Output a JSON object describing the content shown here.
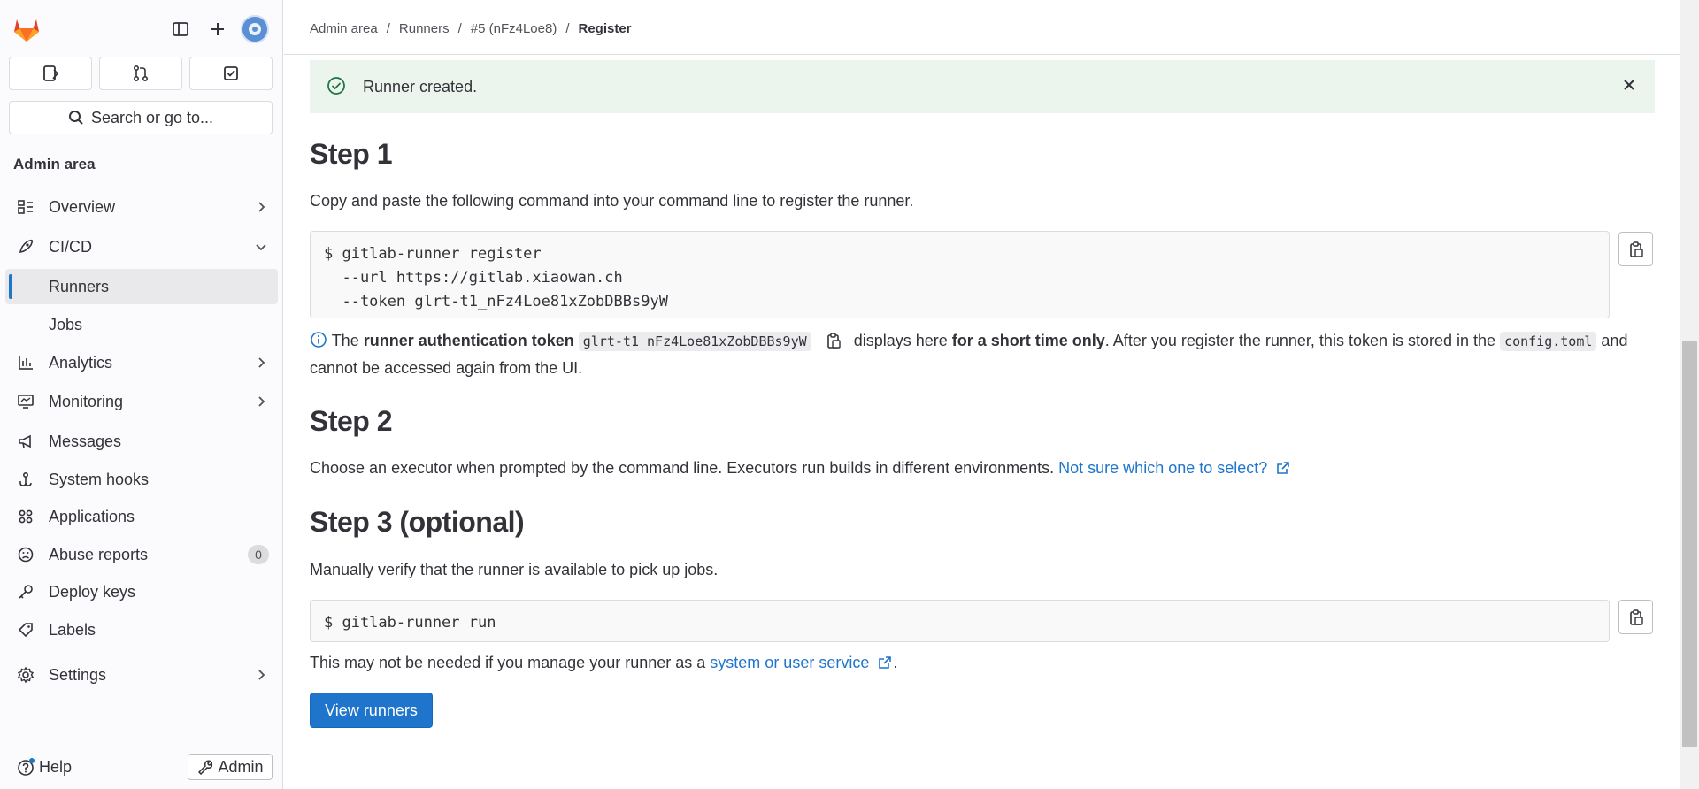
{
  "sidebar": {
    "search_label": "Search or go to...",
    "section_title": "Admin area",
    "items": [
      {
        "label": "Overview"
      },
      {
        "label": "CI/CD"
      },
      {
        "label": "Runners"
      },
      {
        "label": "Jobs"
      },
      {
        "label": "Analytics"
      },
      {
        "label": "Monitoring"
      },
      {
        "label": "Messages"
      },
      {
        "label": "System hooks"
      },
      {
        "label": "Applications"
      },
      {
        "label": "Abuse reports",
        "badge": "0"
      },
      {
        "label": "Deploy keys"
      },
      {
        "label": "Labels"
      },
      {
        "label": "Settings"
      }
    ],
    "help_label": "Help",
    "admin_label": "Admin"
  },
  "breadcrumb": [
    "Admin area",
    "Runners",
    "#5 (nFz4Loe8)",
    "Register"
  ],
  "alert": {
    "text": "Runner created."
  },
  "step1": {
    "title": "Step 1",
    "intro": "Copy and paste the following command into your command line to register the runner.",
    "command": "$ gitlab-runner register\n  --url https://gitlab.xiaowan.ch\n  --token glrt-t1_nFz4Loe81xZobDBBs9yW",
    "info_the": "The",
    "info_bold1": "runner authentication token",
    "token": "glrt-t1_nFz4Loe81xZobDBBs9yW",
    "info_mid": "displays here",
    "info_bold2": "for a short time only",
    "info_after": ". After you register the runner, this token is stored in the",
    "config_file": "config.toml",
    "info_end": "and cannot be accessed again from the UI."
  },
  "step2": {
    "title": "Step 2",
    "text": "Choose an executor when prompted by the command line. Executors run builds in different environments.",
    "link": "Not sure which one to select?"
  },
  "step3": {
    "title": "Step 3 (optional)",
    "text": "Manually verify that the runner is available to pick up jobs.",
    "command": "$ gitlab-runner run",
    "note_before": "This may not be needed if you manage your runner as a",
    "note_link": "system or user service",
    "note_after": "."
  },
  "view_runners_label": "View runners",
  "colors": {
    "accent": "#1f75cb",
    "success_bg": "#ecf4ee",
    "success": "#217645"
  }
}
